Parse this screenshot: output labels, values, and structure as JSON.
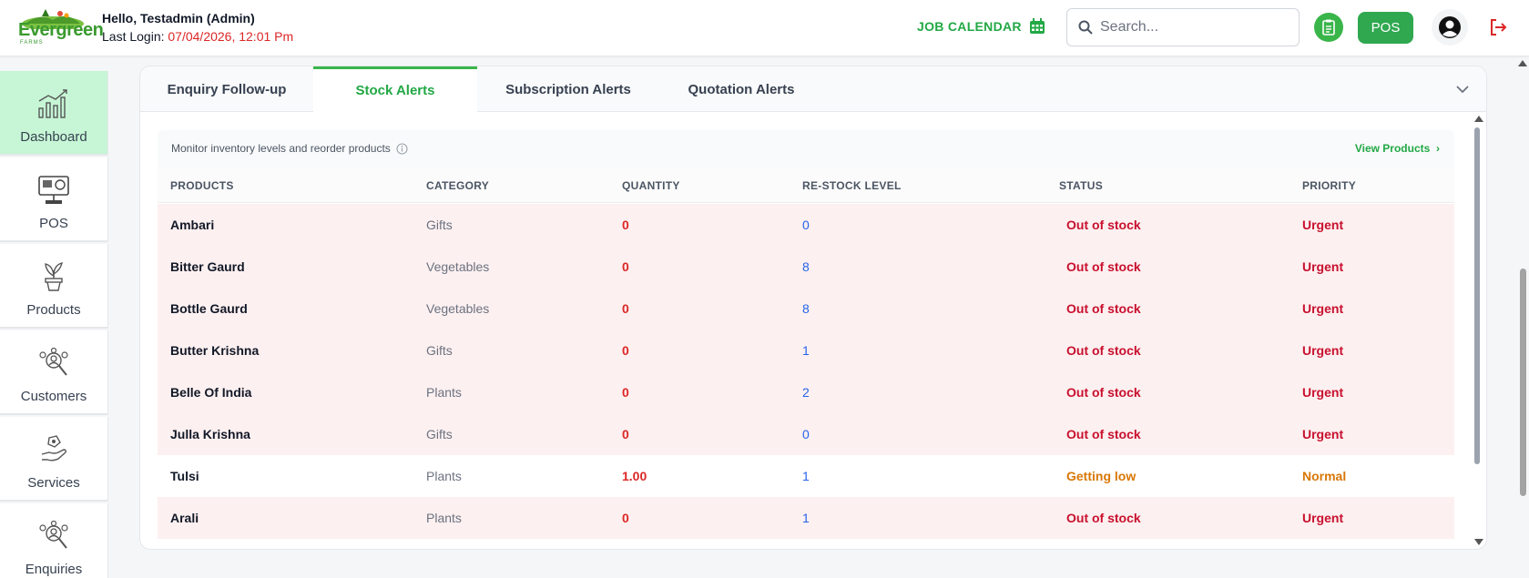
{
  "header": {
    "logo_text": "Evergreen",
    "logo_sub": "FARMS",
    "greeting": "Hello, Testadmin (Admin)",
    "last_login_label": "Last Login: ",
    "last_login_value": "07/04/2026, 12:01 Pm",
    "job_calendar_label": "JOB CALENDAR",
    "search_placeholder": "Search...",
    "pos_label": "POS",
    "colors": {
      "accent": "#22a845",
      "danger": "#dc2626"
    }
  },
  "sidebar": {
    "items": [
      {
        "label": "Dashboard",
        "icon": "chart-icon",
        "active": true
      },
      {
        "label": "POS",
        "icon": "pos-terminal-icon",
        "active": false
      },
      {
        "label": "Products",
        "icon": "plant-pot-icon",
        "active": false
      },
      {
        "label": "Customers",
        "icon": "customers-icon",
        "active": false
      },
      {
        "label": "Services",
        "icon": "services-icon",
        "active": false
      },
      {
        "label": "Enquiries",
        "icon": "enquiries-icon",
        "active": false
      }
    ]
  },
  "tabs": [
    {
      "label": "Enquiry Follow-up",
      "active": false
    },
    {
      "label": "Stock Alerts",
      "active": true
    },
    {
      "label": "Subscription Alerts",
      "active": false
    },
    {
      "label": "Quotation Alerts",
      "active": false
    }
  ],
  "stock": {
    "info": "Monitor inventory levels and reorder products",
    "view_products": "View Products",
    "columns": [
      "PRODUCTS",
      "CATEGORY",
      "QUANTITY",
      "RE-STOCK LEVEL",
      "STATUS",
      "PRIORITY"
    ],
    "rows": [
      {
        "product": "Ambari",
        "category": "Gifts",
        "quantity": "0",
        "restock": "0",
        "status": "Out of stock",
        "priority": "Urgent"
      },
      {
        "product": "Bitter Gaurd",
        "category": "Vegetables",
        "quantity": "0",
        "restock": "8",
        "status": "Out of stock",
        "priority": "Urgent"
      },
      {
        "product": "Bottle Gaurd",
        "category": "Vegetables",
        "quantity": "0",
        "restock": "8",
        "status": "Out of stock",
        "priority": "Urgent"
      },
      {
        "product": "Butter Krishna",
        "category": "Gifts",
        "quantity": "0",
        "restock": "1",
        "status": "Out of stock",
        "priority": "Urgent"
      },
      {
        "product": "Belle Of India",
        "category": "Plants",
        "quantity": "0",
        "restock": "2",
        "status": "Out of stock",
        "priority": "Urgent"
      },
      {
        "product": "Julla Krishna",
        "category": "Gifts",
        "quantity": "0",
        "restock": "0",
        "status": "Out of stock",
        "priority": "Urgent"
      },
      {
        "product": "Tulsi",
        "category": "Plants",
        "quantity": "1.00",
        "restock": "1",
        "status": "Getting low",
        "priority": "Normal"
      },
      {
        "product": "Arali",
        "category": "Plants",
        "quantity": "0",
        "restock": "1",
        "status": "Out of stock",
        "priority": "Urgent"
      }
    ]
  }
}
